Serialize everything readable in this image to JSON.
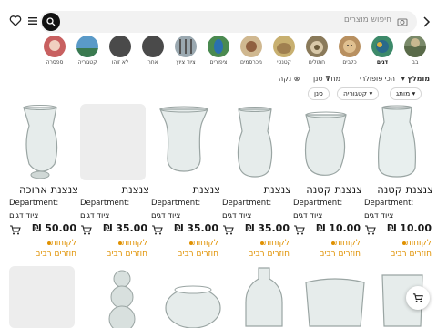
{
  "search": {
    "placeholder": "חיפוש מוצרים"
  },
  "categories": [
    {
      "label": "בב",
      "selected": false
    },
    {
      "label": "דגים",
      "selected": true
    },
    {
      "label": "כלבים",
      "selected": false
    },
    {
      "label": "חתולים",
      "selected": false
    },
    {
      "label": "קטנטי",
      "selected": false
    },
    {
      "label": "מכרסמים",
      "selected": false
    },
    {
      "label": "ציפורים",
      "selected": false
    },
    {
      "label": "ציוד ציוץ",
      "selected": false
    },
    {
      "label": "אחר",
      "selected": false
    },
    {
      "label": "לא זוהו",
      "selected": false
    },
    {
      "label": "קטגוריה",
      "selected": false
    },
    {
      "label": "ספסרה",
      "selected": false
    }
  ],
  "filters": {
    "sort_label": "מומלץ",
    "popular_label": "הכי פופולרי",
    "price_label": "מחיר",
    "filter_label": "סנן",
    "clear_label": "נקה",
    "brand_chip": "מותג",
    "category_chip": "קטגוריה",
    "filter_chip": "סנן"
  },
  "products": [
    {
      "title": "צנצנת קטנה",
      "dept_label": "Department:",
      "dept_value": "ציוד דגים",
      "price": "₪ 10.00",
      "promo1": "לקוחות",
      "promo2": "חוזרים רבים"
    },
    {
      "title": "צנצנת קטנה",
      "dept_label": "Department:",
      "dept_value": "ציוד דגים",
      "price": "₪ 10.00",
      "promo1": "לקוחות",
      "promo2": "חוזרים רבים"
    },
    {
      "title": "צנצנת",
      "dept_label": "Department:",
      "dept_value": "ציוד דגים",
      "price": "₪ 35.00",
      "promo1": "לקוחות",
      "promo2": "חוזרים רבים"
    },
    {
      "title": "צנצנת",
      "dept_label": "Department:",
      "dept_value": "ציוד דגים",
      "price": "₪ 35.00",
      "promo1": "לקוחות",
      "promo2": "חוזרים רבים"
    },
    {
      "title": "צנצנת",
      "dept_label": "Department:",
      "dept_value": "ציוד דגים",
      "price": "₪ 35.00",
      "promo1": "לקוחות",
      "promo2": "חוזרים רבים"
    },
    {
      "title": "צנצנת ארוכה",
      "dept_label": "Department:",
      "dept_value": "ציוד דגים",
      "price": "₪ 50.00",
      "promo1": "לקוחות",
      "promo2": "חוזרים רבים"
    }
  ],
  "colors": {
    "accent": "#e09100",
    "text": "#1a1a1a",
    "muted": "#8a8a8a"
  }
}
